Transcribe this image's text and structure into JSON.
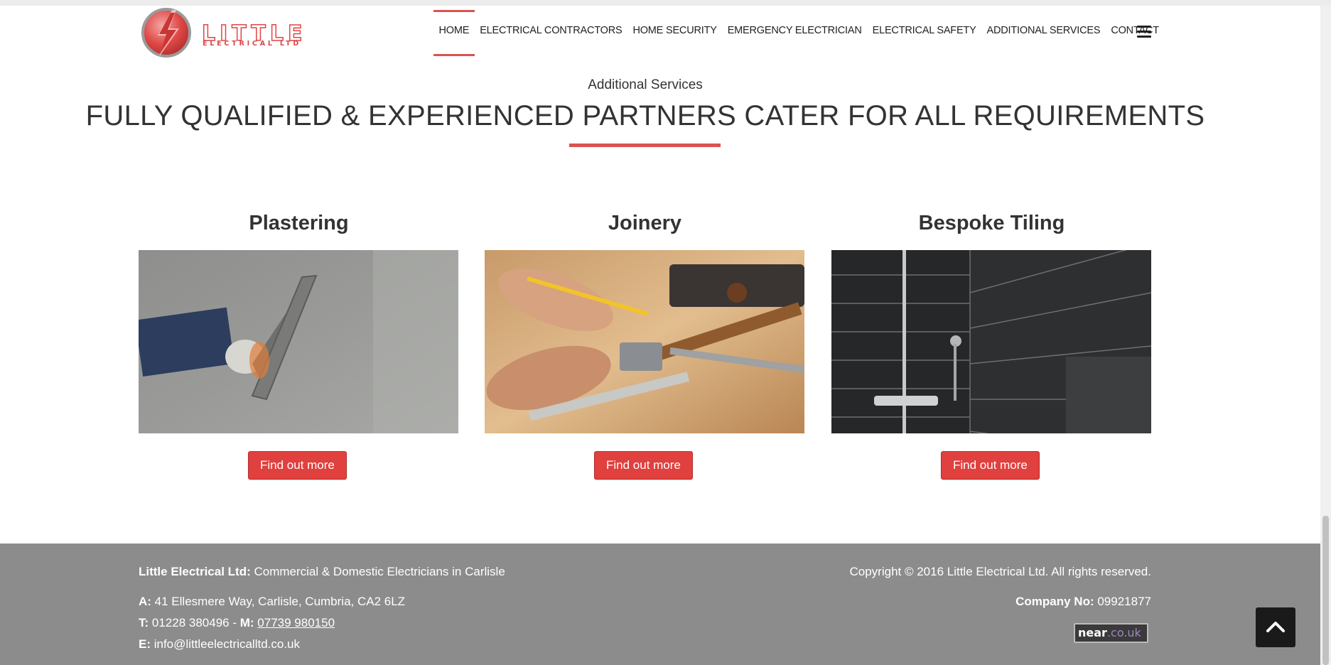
{
  "brand": {
    "logo_line1": "LITTLE",
    "logo_line2": "ELECTRICAL LTD",
    "accent": "#d9534f"
  },
  "nav": {
    "items": [
      {
        "label": "HOME",
        "active": true
      },
      {
        "label": "ELECTRICAL CONTRACTORS"
      },
      {
        "label": "HOME SECURITY"
      },
      {
        "label": "EMERGENCY ELECTRICIAN"
      },
      {
        "label": "ELECTRICAL SAFETY"
      },
      {
        "label": "ADDITIONAL SERVICES"
      },
      {
        "label": "CONTACT"
      }
    ],
    "menu_icon": "hamburger-icon"
  },
  "section": {
    "subtitle": "Additional Services",
    "title": "FULLY QUALIFIED & EXPERIENCED PARTNERS CATER FOR ALL REQUIREMENTS"
  },
  "cards": [
    {
      "title": "Plastering",
      "button": "Find out more",
      "image": "plastering-photo"
    },
    {
      "title": "Joinery",
      "button": "Find out more",
      "image": "joinery-photo"
    },
    {
      "title": "Bespoke Tiling",
      "button": "Find out more",
      "image": "tiling-photo"
    }
  ],
  "footer": {
    "company_label": "Little Electrical Ltd:",
    "company_desc": " Commercial & Domestic Electricians in Carlisle",
    "address_label": "A:",
    "address": " 41 Ellesmere Way, Carlisle, Cumbria, CA2 6LZ",
    "tel_label": "T:",
    "tel": " 01228 380496 - ",
    "mobile_label": "M:",
    "mobile": "07739 980150",
    "email_label": "E:",
    "email": " info@littleelectricalltd.co.uk",
    "copyright": "Copyright © 2016 Little Electrical Ltd. All rights reserved.",
    "company_no_label": "Company No:",
    "company_no": " 09921877",
    "badge_name": "near",
    "badge_domain": ".co.uk"
  },
  "scroll_top_icon": "chevron-up-icon"
}
